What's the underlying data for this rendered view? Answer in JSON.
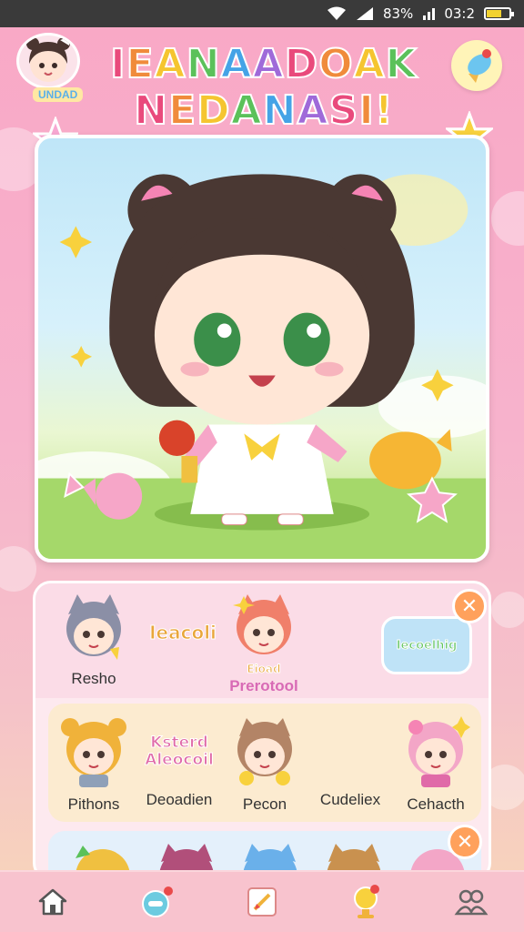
{
  "status_bar": {
    "battery_text": "83%",
    "time": "03:2"
  },
  "header": {
    "avatar_label": "UNDAD",
    "title_line1": "IEANAADOAK",
    "title_line2": "NEDANASI!",
    "title_colors": [
      "#e94a7c",
      "#f08b3b",
      "#f5c530",
      "#5bc15a",
      "#45a3e6",
      "#9f6ad9"
    ]
  },
  "roster": {
    "row1": [
      {
        "name": "Resho",
        "kind": "character",
        "hair": "#8b8fa6"
      },
      {
        "name": "Ieacoli",
        "kind": "logo"
      },
      {
        "name": "Prerotool",
        "kind": "character",
        "hair": "#f07f6a",
        "badge": "Eioad"
      },
      {
        "name": "Iecoelhig",
        "kind": "logo-badge"
      }
    ],
    "row2": [
      {
        "name": "Pithons",
        "hair": "#f0b23a"
      },
      {
        "name": "Deoadien",
        "logo": "Ksterd Aleocoil"
      },
      {
        "name": "Pecon",
        "hair": "#b38466"
      },
      {
        "name": "Cudeliex",
        "hair": "#ffffff"
      },
      {
        "name": "Cehacth",
        "hair": "#f3a6c7"
      }
    ],
    "row3_hair": [
      "#f0c040",
      "#b14f7a",
      "#6ab0ea",
      "#c9914f",
      "#f3a6c7"
    ]
  },
  "icons": {
    "top_right": "ice-cream-icon",
    "close": "close-icon",
    "nav": [
      "home-icon",
      "gamepad-icon",
      "notes-icon",
      "trophy-icon",
      "friends-icon"
    ]
  },
  "colors": {
    "accent": "#ffa15c",
    "pink": "#f9a8c6",
    "nav_bg": "#f8c3ce"
  }
}
